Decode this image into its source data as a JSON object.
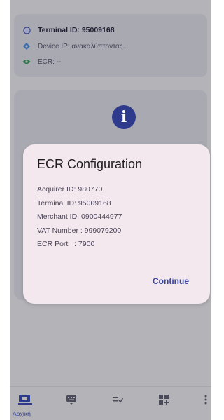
{
  "info_card": {
    "terminal_id": "Terminal ID: 95009168",
    "device_ip": "Device IP: ανακαλύπτοντας...",
    "ecr": "ECR: --"
  },
  "dialog": {
    "title": "ECR Configuration",
    "lines": [
      "Acquirer ID: 980770",
      "Terminal ID: 95009168",
      "Merchant ID: 0900444977",
      "VAT Number : 999079200",
      "ECR Port   : 7900"
    ],
    "continue_label": "Continue"
  },
  "bottom_nav": {
    "home_label": "Αρχική",
    "items": [
      "home-icon",
      "keyboard-icon",
      "checklist-icon",
      "add-grid-icon",
      "more-vert-icon"
    ]
  },
  "colors": {
    "accent": "#2e3a8c",
    "dialog_bg": "#f3e8ed",
    "scrim": "#b3b3b8"
  }
}
